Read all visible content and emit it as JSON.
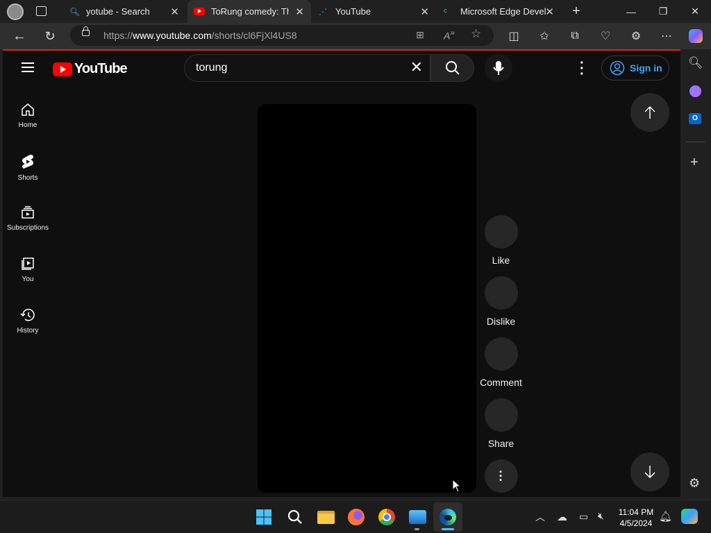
{
  "browser": {
    "tabs": [
      {
        "label": "yotube - Search",
        "icon": "search-icon"
      },
      {
        "label": "ToRung comedy: The",
        "icon": "youtube-icon"
      },
      {
        "label": "YouTube",
        "icon": "loading-icon"
      },
      {
        "label": "Microsoft Edge Devel",
        "icon": "edge-dev-icon"
      }
    ],
    "address": {
      "scheme": "https://",
      "host": "www.youtube.com",
      "path": "/shorts/cl6FjXl4US8"
    }
  },
  "youtube": {
    "logo_text": "YouTube",
    "search": {
      "value": "torung"
    },
    "signin_label": "Sign in",
    "nav": [
      {
        "label": "Home",
        "icon": "home-icon"
      },
      {
        "label": "Shorts",
        "icon": "shorts-icon"
      },
      {
        "label": "Subscriptions",
        "icon": "subscriptions-icon"
      },
      {
        "label": "You",
        "icon": "you-icon"
      },
      {
        "label": "History",
        "icon": "history-icon"
      }
    ],
    "actions": [
      {
        "label": "Like"
      },
      {
        "label": "Dislike"
      },
      {
        "label": "Comment"
      },
      {
        "label": "Share"
      }
    ],
    "colors": {
      "brand_red": "#ff0000",
      "link_blue": "#3ea6ff"
    }
  },
  "taskbar": {
    "time": "11:04 PM",
    "date": "4/5/2024"
  }
}
